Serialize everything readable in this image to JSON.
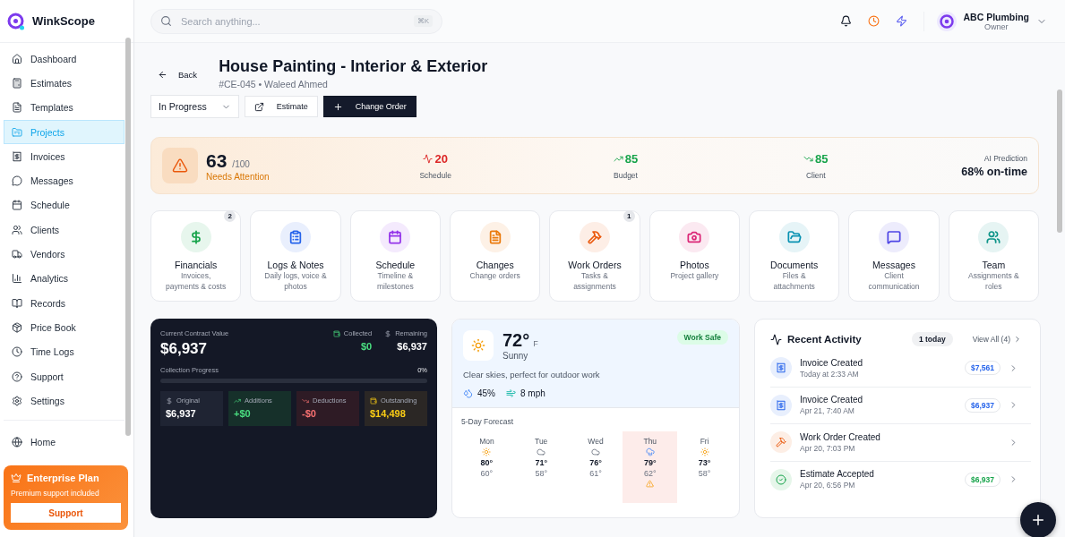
{
  "brand": {
    "name": "WinkScope"
  },
  "sidebar": {
    "items": [
      {
        "label": "Dashboard",
        "selected": false
      },
      {
        "label": "Estimates",
        "selected": false
      },
      {
        "label": "Templates",
        "selected": false
      },
      {
        "label": "Projects",
        "selected": true
      },
      {
        "label": "Invoices",
        "selected": false
      },
      {
        "label": "Messages",
        "selected": false
      },
      {
        "label": "Schedule",
        "selected": false
      },
      {
        "label": "Clients",
        "selected": false
      },
      {
        "label": "Vendors",
        "selected": false
      },
      {
        "label": "Analytics",
        "selected": false
      },
      {
        "label": "Records",
        "selected": false
      },
      {
        "label": "Price Book",
        "selected": false
      },
      {
        "label": "Time Logs",
        "selected": false
      },
      {
        "label": "Support",
        "selected": false
      },
      {
        "label": "Settings",
        "selected": false
      }
    ],
    "home": "Home",
    "plan": {
      "title": "Enterprise Plan",
      "subtitle": "Premium support included",
      "button": "Support"
    }
  },
  "topbar": {
    "search_placeholder": "Search anything...",
    "shortcut": "⌘K",
    "user": {
      "name": "ABC Plumbing",
      "role": "Owner"
    }
  },
  "project": {
    "back": "Back",
    "title": "House Painting - Interior & Exterior",
    "code": "#CE-045",
    "separator": "•",
    "client": "Waleed Ahmed",
    "status": "In Progress",
    "estimate_button": "Estimate",
    "change_order_button": "Change Order"
  },
  "health": {
    "score": "63",
    "max": "/100",
    "status": "Needs Attention",
    "metrics": [
      {
        "kind": "pulse",
        "value": "20",
        "label": "Schedule",
        "color": "#dc2626"
      },
      {
        "kind": "up",
        "value": "85",
        "label": "Budget",
        "color": "#16a34a"
      },
      {
        "kind": "down",
        "value": "85",
        "label": "Client",
        "color": "#16a34a"
      }
    ],
    "prediction_label": "AI Prediction",
    "prediction": "68% on-time"
  },
  "tiles": [
    {
      "title": "Financials",
      "subtitle": "Invoices, payments & costs",
      "badge": "2",
      "color": "#16a34a"
    },
    {
      "title": "Logs & Notes",
      "subtitle": "Daily logs, voice & photos",
      "color": "#2563eb"
    },
    {
      "title": "Schedule",
      "subtitle": "Timeline & milestones",
      "color": "#9333ea"
    },
    {
      "title": "Changes",
      "subtitle": "Change orders",
      "color": "#ea7a0c"
    },
    {
      "title": "Work Orders",
      "subtitle": "Tasks & assignments",
      "badge": "1",
      "color": "#ea580c"
    },
    {
      "title": "Photos",
      "subtitle": "Project gallery",
      "color": "#db2777"
    },
    {
      "title": "Documents",
      "subtitle": "Files & attachments",
      "color": "#0891b2"
    },
    {
      "title": "Messages",
      "subtitle": "Client communication",
      "color": "#4f46e5"
    },
    {
      "title": "Team",
      "subtitle": "Assignments & roles",
      "color": "#0d9488"
    }
  ],
  "finance": {
    "label": "Current Contract Value",
    "value": "$6,937",
    "collected_label": "Collected",
    "collected": "$0",
    "remaining_label": "Remaining",
    "remaining": "$6,937",
    "progress_label": "Collection Progress",
    "progress_text": "0%",
    "level": 0,
    "boxes": [
      {
        "kind": "original",
        "label": "Original",
        "value": "$6,937"
      },
      {
        "kind": "additions",
        "label": "Additions",
        "value": "+$0"
      },
      {
        "kind": "deductions",
        "label": "Deductions",
        "value": "-$0"
      },
      {
        "kind": "outstanding",
        "label": "Outstanding",
        "value": "$14,498"
      }
    ]
  },
  "weather": {
    "temp": "72°",
    "unit": "F",
    "condition": "Sunny",
    "badge": "Work Safe",
    "summary": "Clear skies, perfect for outdoor work",
    "humidity": "45%",
    "wind": "8 mph",
    "forecast_title": "5-Day Forecast",
    "days": [
      {
        "day": "Mon",
        "kind": "sunny",
        "high": "80°",
        "low": "60°",
        "alert": false
      },
      {
        "day": "Tue",
        "kind": "cloudy",
        "high": "71°",
        "low": "58°",
        "alert": false
      },
      {
        "day": "Wed",
        "kind": "cloudy",
        "high": "76°",
        "low": "61°",
        "alert": false
      },
      {
        "day": "Thu",
        "kind": "rain",
        "high": "79°",
        "low": "62°",
        "alert": true
      },
      {
        "day": "Fri",
        "kind": "sunny",
        "high": "73°",
        "low": "58°",
        "alert": false
      }
    ]
  },
  "activity": {
    "title": "Recent Activity",
    "today": "1 today",
    "view_all": "View All (4)",
    "items": [
      {
        "kind": "invoice",
        "title": "Invoice Created",
        "time": "Today at 2:33 AM",
        "amount": "$7,561"
      },
      {
        "kind": "invoice",
        "title": "Invoice Created",
        "time": "Apr 21, 7:40 AM",
        "amount": "$6,937"
      },
      {
        "kind": "work_order",
        "title": "Work Order Created",
        "time": "Apr 20, 7:03 PM"
      },
      {
        "kind": "estimate",
        "title": "Estimate Accepted",
        "time": "Apr 20, 6:56 PM",
        "amount": "$6,937"
      }
    ]
  }
}
